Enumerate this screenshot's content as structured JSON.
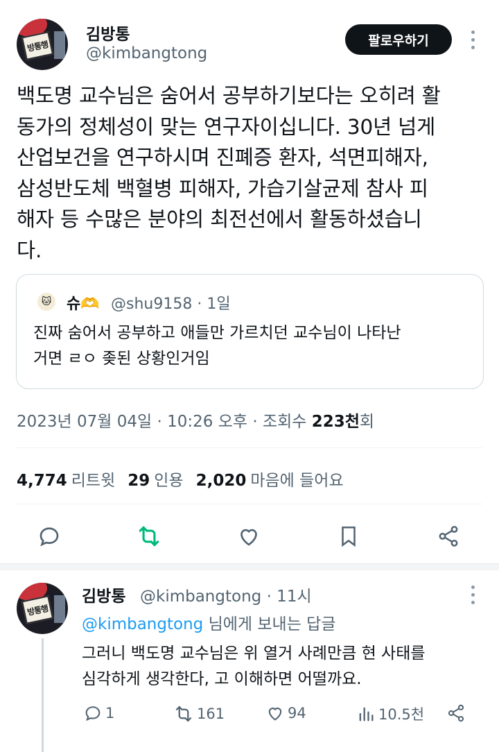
{
  "tweet": {
    "author_name": "김방통",
    "author_handle": "@kimbangtong",
    "follow_label": "팔로우하기",
    "text": "백도명 교수님은 숨어서 공부하기보다는 오히려 활\n동가의 정체성이 맞는 연구자이십니다. 30년 넘게\n산업보건을 연구하시며 진폐증 환자, 석면피해자,\n삼성반도체 백혈병 피해자, 가습기살균제 참사 피\n해자 등 수많은 분야의 최전선에서 활동하셨습니\n다.",
    "avatar_sign": "방통행",
    "quote": {
      "name": "슈🫶",
      "handle_time": "@shu9158 · 1일",
      "text": "진짜 숨어서 공부하고 애들만 가르치던 교수님이 나타난\n거면 ㄹㅇ 좆된 상황인거임"
    },
    "meta_prefix": "2023년 07월 04일 · 10:26 오후 · 조회수 ",
    "views": "223천",
    "views_suffix": "회",
    "stats": {
      "retweets": "4,774",
      "retweets_label": "리트윗",
      "quotes": "29",
      "quotes_label": "인용",
      "likes": "2,020",
      "likes_label": "마음에 들어요"
    },
    "icons": [
      "reply-icon",
      "retweet-icon",
      "like-icon",
      "bookmark-icon",
      "share-icon"
    ],
    "retweet_color": "#00ba7c"
  },
  "reply": {
    "author_name": "김방통",
    "handle_time": "@kimbangtong · 11시",
    "reply_to_mention": "@kimbangtong",
    "reply_to_suffix": " 님에게 보내는 답글",
    "text": "그러니 백도명 교수님은 위 열거 사례만큼 현 사태를\n심각하게 생각한다, 고 이해하면 어떨까요.",
    "counts": {
      "replies": "1",
      "retweets": "161",
      "likes": "94",
      "views": "10.5천"
    }
  }
}
